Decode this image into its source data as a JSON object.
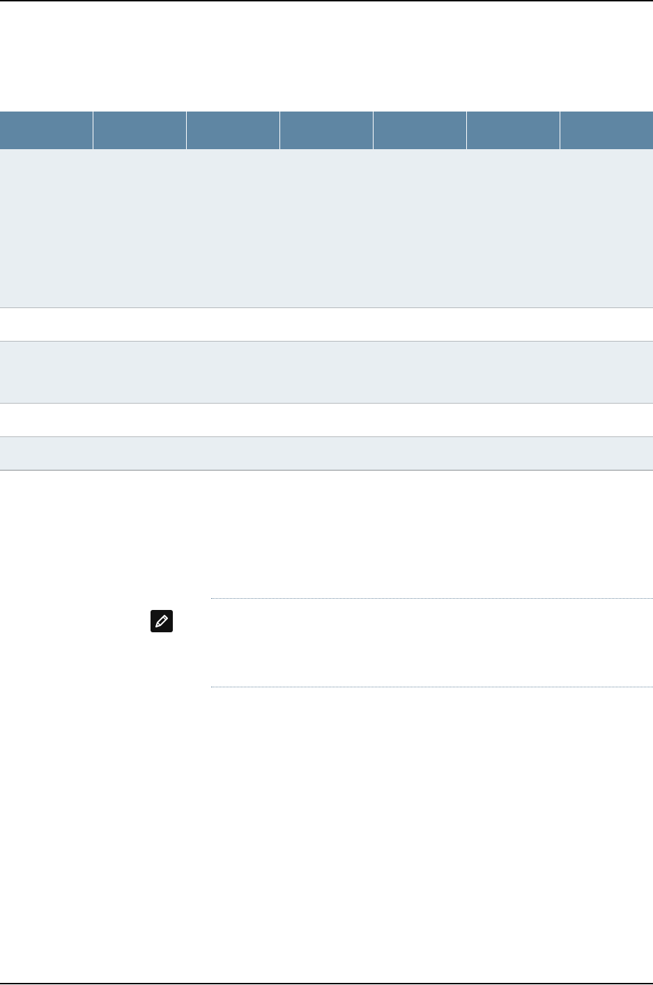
{
  "colors": {
    "header_fill": "#5f86a3",
    "row_shaded": "#e8eef2",
    "row_plain": "#ffffff",
    "row_divider": "#b5b9bd",
    "note_rule": "#6d8aa1"
  },
  "table": {
    "columns": [
      "",
      "",
      "",
      "",
      "",
      "",
      ""
    ],
    "rows": [
      {
        "shade": "row_shaded"
      },
      {
        "shade": "row_plain"
      },
      {
        "shade": "row_shaded"
      },
      {
        "shade": "row_plain"
      },
      {
        "shade": "row_shaded"
      }
    ]
  },
  "note": {
    "icon": "pencil-note-icon"
  }
}
